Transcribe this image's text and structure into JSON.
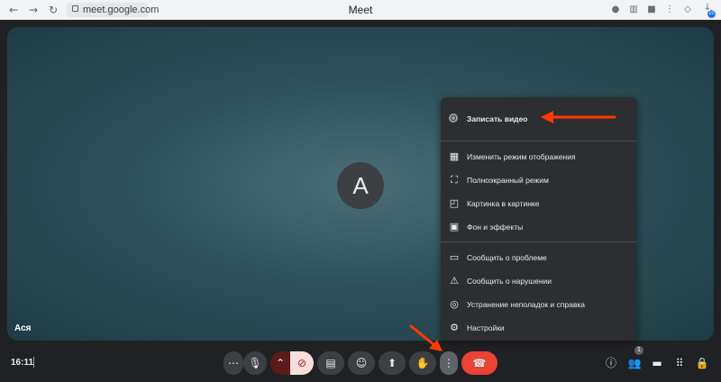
{
  "browser": {
    "url": "meet.google.com",
    "title": "Meet",
    "extension_badge": "10"
  },
  "stage": {
    "avatar_letter": "A",
    "participant_name": "Ася"
  },
  "menu": {
    "record_label": "Записать видео",
    "group1": [
      {
        "icon": "layout-icon",
        "label": "Изменить режим отображения"
      },
      {
        "icon": "fullscreen-icon",
        "label": "Полноэкранный режим"
      },
      {
        "icon": "picture-in-picture-icon",
        "label": "Картинка в картинке"
      },
      {
        "icon": "background-effects-icon",
        "label": "Фон и эффекты"
      }
    ],
    "group2": [
      {
        "icon": "feedback-icon",
        "label": "Сообщить о проблеме"
      },
      {
        "icon": "report-abuse-icon",
        "label": "Сообщить о нарушении"
      },
      {
        "icon": "troubleshoot-icon",
        "label": "Устранение неполадок и справка"
      },
      {
        "icon": "settings-icon",
        "label": "Настройки"
      }
    ]
  },
  "bottom_bar": {
    "time": "16:11",
    "people_count": "1"
  },
  "colors": {
    "annotation_arrow": "#ff3b00",
    "end_call": "#ea4335"
  }
}
